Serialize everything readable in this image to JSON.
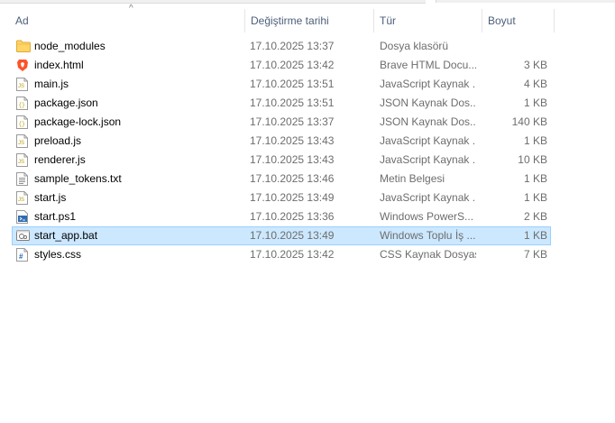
{
  "columns": {
    "name": "Ad",
    "modified": "Değiştirme tarihi",
    "type": "Tür",
    "size": "Boyut"
  },
  "files": [
    {
      "name": "node_modules",
      "modified": "17.10.2025 13:37",
      "type": "Dosya klasörü",
      "size": "",
      "icon": "folder-icon"
    },
    {
      "name": "index.html",
      "modified": "17.10.2025 13:42",
      "type": "Brave HTML Docu...",
      "size": "3 KB",
      "icon": "brave-html-icon"
    },
    {
      "name": "main.js",
      "modified": "17.10.2025 13:51",
      "type": "JavaScript Kaynak ...",
      "size": "4 KB",
      "icon": "js-file-icon"
    },
    {
      "name": "package.json",
      "modified": "17.10.2025 13:51",
      "type": "JSON Kaynak Dos...",
      "size": "1 KB",
      "icon": "json-file-icon"
    },
    {
      "name": "package-lock.json",
      "modified": "17.10.2025 13:37",
      "type": "JSON Kaynak Dos...",
      "size": "140 KB",
      "icon": "json-file-icon"
    },
    {
      "name": "preload.js",
      "modified": "17.10.2025 13:43",
      "type": "JavaScript Kaynak ...",
      "size": "1 KB",
      "icon": "js-file-icon"
    },
    {
      "name": "renderer.js",
      "modified": "17.10.2025 13:43",
      "type": "JavaScript Kaynak ...",
      "size": "10 KB",
      "icon": "js-file-icon"
    },
    {
      "name": "sample_tokens.txt",
      "modified": "17.10.2025 13:46",
      "type": "Metin Belgesi",
      "size": "1 KB",
      "icon": "text-file-icon"
    },
    {
      "name": "start.js",
      "modified": "17.10.2025 13:49",
      "type": "JavaScript Kaynak ...",
      "size": "1 KB",
      "icon": "js-file-icon"
    },
    {
      "name": "start.ps1",
      "modified": "17.10.2025 13:36",
      "type": "Windows PowerS...",
      "size": "2 KB",
      "icon": "powershell-file-icon"
    },
    {
      "name": "start_app.bat",
      "modified": "17.10.2025 13:49",
      "type": "Windows Toplu İş ...",
      "size": "1 KB",
      "icon": "batch-file-icon"
    },
    {
      "name": "styles.css",
      "modified": "17.10.2025 13:42",
      "type": "CSS Kaynak Dosyası",
      "size": "7 KB",
      "icon": "css-file-icon"
    }
  ],
  "selected_row": 10,
  "colors": {
    "header_text": "#4c607a",
    "selection_fill": "#cce8ff",
    "selection_border": "#99d1ff",
    "secondary_text": "#6d6d6d"
  }
}
